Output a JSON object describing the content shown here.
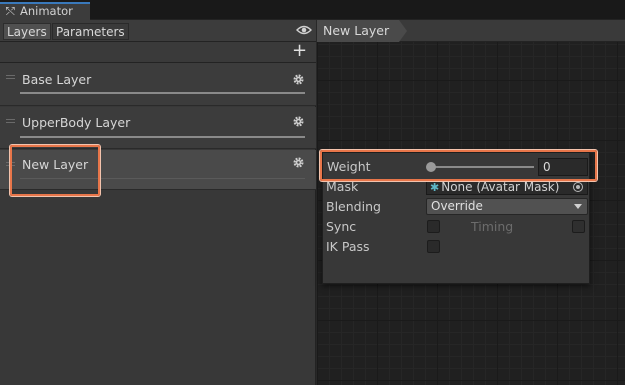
{
  "window": {
    "tab_title": "Animator"
  },
  "left_panel": {
    "tabs": [
      {
        "label": "Layers",
        "active": true
      },
      {
        "label": "Parameters",
        "active": false
      }
    ],
    "layers": [
      {
        "name": "Base Layer",
        "weight": 1.0
      },
      {
        "name": "UpperBody Layer",
        "weight": 1.0
      },
      {
        "name": "New Layer",
        "weight": 0
      }
    ]
  },
  "graph": {
    "breadcrumb": "New Layer"
  },
  "layer_settings": {
    "weight_label": "Weight",
    "weight_value": "0",
    "mask_label": "Mask",
    "mask_value": "None (Avatar Mask)",
    "blending_label": "Blending",
    "blending_value": "Override",
    "sync_label": "Sync",
    "timing_label": "Timing",
    "ikpass_label": "IK Pass"
  },
  "colors": {
    "highlight": "#e8764a",
    "accent": "#3a79bb"
  }
}
